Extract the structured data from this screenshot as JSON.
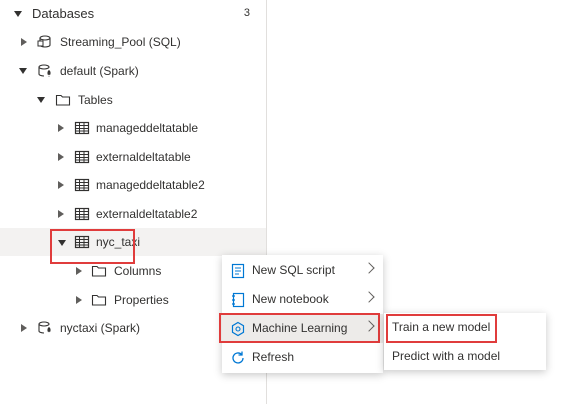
{
  "tree": {
    "header": {
      "label": "Databases",
      "count": "3"
    },
    "nodes": {
      "streaming_pool": "Streaming_Pool (SQL)",
      "default_spark": "default (Spark)",
      "tables": "Tables",
      "t1": "manageddeltatable",
      "t2": "externaldeltatable",
      "t3": "manageddeltatable2",
      "t4": "externaldeltatable2",
      "t5": "nyc_taxi",
      "columns": "Columns",
      "properties": "Properties",
      "nyctaxi_spark": "nyctaxi (Spark)"
    }
  },
  "context_menu": {
    "items": {
      "new_sql": "New SQL script",
      "new_notebook": "New notebook",
      "ml": "Machine Learning",
      "refresh": "Refresh"
    }
  },
  "submenu": {
    "items": {
      "train": "Train a new model",
      "predict": "Predict with a model"
    }
  },
  "colors": {
    "highlight": "#e03c3c",
    "accent": "#0078d4"
  }
}
